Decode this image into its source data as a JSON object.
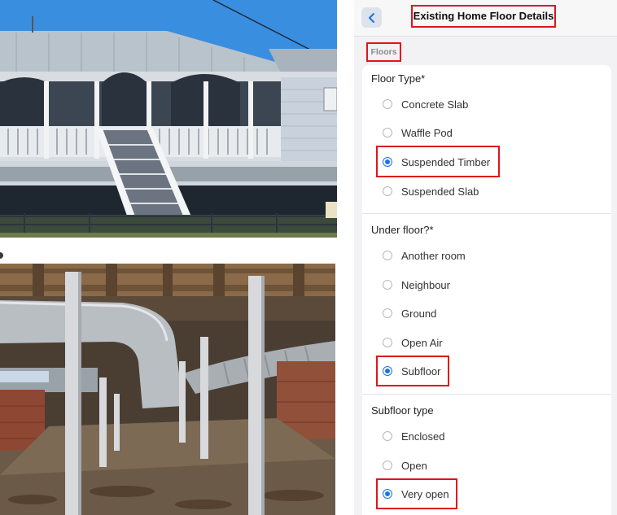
{
  "header": {
    "back_icon": "chevron-left-icon",
    "title": "Existing Home Floor Details"
  },
  "section": {
    "label": "Floors"
  },
  "floor_type": {
    "label": "Floor Type*",
    "options": [
      "Concrete Slab",
      "Waffle Pod",
      "Suspended Timber",
      "Suspended Slab"
    ],
    "selected": "Suspended Timber"
  },
  "under_floor": {
    "label": "Under floor?*",
    "options": [
      "Another room",
      "Neighbour",
      "Ground",
      "Open Air",
      "Subfloor"
    ],
    "selected": "Subfloor"
  },
  "subfloor_type": {
    "label": "Subfloor type",
    "options": [
      "Enclosed",
      "Open",
      "Very open"
    ],
    "selected": "Very open"
  },
  "colors": {
    "highlight": "#e0141b",
    "accent": "#1a73e8"
  }
}
